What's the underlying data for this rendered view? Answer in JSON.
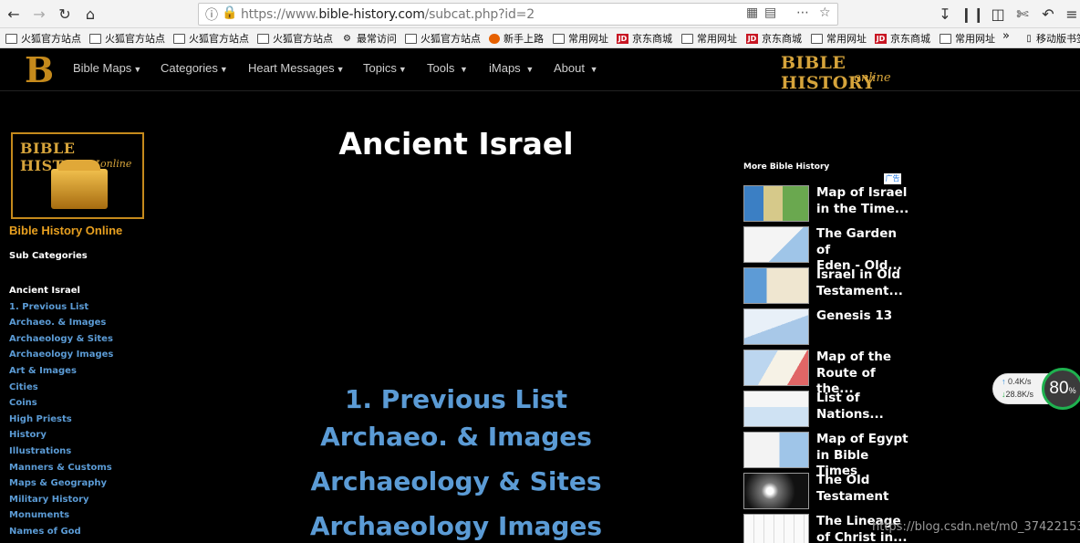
{
  "browser": {
    "url_prefix": "https://www.",
    "url_domain": "bible-history.com",
    "url_path": "/subcat.php?id=2",
    "bookmarks": [
      {
        "label": "火狐官方站点",
        "icon": "folder-icon"
      },
      {
        "label": "火狐官方站点",
        "icon": "folder-icon"
      },
      {
        "label": "火狐官方站点",
        "icon": "folder-icon"
      },
      {
        "label": "火狐官方站点",
        "icon": "folder-icon"
      },
      {
        "label": "最常访问",
        "icon": "gear-icon"
      },
      {
        "label": "火狐官方站点",
        "icon": "folder-icon"
      },
      {
        "label": "新手上路",
        "icon": "firefox-icon"
      },
      {
        "label": "常用网址",
        "icon": "folder-icon"
      },
      {
        "label": "京东商城",
        "icon": "jd-icon"
      },
      {
        "label": "常用网址",
        "icon": "folder-icon"
      },
      {
        "label": "京东商城",
        "icon": "jd-icon"
      },
      {
        "label": "常用网址",
        "icon": "folder-icon"
      },
      {
        "label": "京东商城",
        "icon": "jd-icon"
      },
      {
        "label": "常用网址",
        "icon": "folder-icon"
      }
    ],
    "overflow": "»",
    "mobile_bookmarks": "移动版书签"
  },
  "nav": {
    "logo_letter": "B",
    "items": [
      "Bible Maps",
      "Categories",
      "Heart Messages",
      "Topics",
      "Tools",
      "iMaps",
      "About"
    ],
    "brand_line1": "BIBLE HISTORY",
    "brand_line2": "online"
  },
  "sidebar": {
    "logo_line1": "BIBLE HISTORY",
    "logo_line2": "online",
    "site_title": "Bible History Online",
    "sub_heading": "Sub Categories",
    "items": [
      "Ancient Israel",
      "1. Previous List",
      "Archaeo. & Images",
      "Archaeology & Sites",
      "Archaeology Images",
      "Art & Images",
      "Cities",
      "Coins",
      "High Priests",
      "History",
      "Illustrations",
      "Manners & Customs",
      "Maps & Geography",
      "Military History",
      "Monuments",
      "Names of God"
    ]
  },
  "main": {
    "title": "Ancient Israel",
    "links": [
      "1. Previous List",
      "Archaeo. & Images",
      "Archaeology & Sites",
      "Archaeology Images"
    ]
  },
  "right": {
    "heading": "More Bible History",
    "ad_badge": "广告",
    "items": [
      {
        "l1": "Map of Israel",
        "l2": "in the Time..."
      },
      {
        "l1": "The Garden of",
        "l2": "Eden - Old..."
      },
      {
        "l1": "Israel in Old",
        "l2": "Testament..."
      },
      {
        "l1": "Genesis 13",
        "l2": ""
      },
      {
        "l1": "Map of the",
        "l2": "Route of the..."
      },
      {
        "l1": "List of",
        "l2": "Nations..."
      },
      {
        "l1": "Map of Egypt",
        "l2": "in Bible Times"
      },
      {
        "l1": "The Old",
        "l2": "Testament"
      },
      {
        "l1": "The Lineage",
        "l2": "of Christ in..."
      }
    ]
  },
  "widget": {
    "up": "0.4K/s",
    "down": "28.8K/s",
    "percent": "80",
    "percent_sign": "%"
  },
  "watermark": "https://blog.csdn.net/m0_37422153",
  "colors": {
    "accent_gold": "#d6a43b",
    "link_blue": "#5b9bd5",
    "sub_orange": "#e8a020"
  }
}
